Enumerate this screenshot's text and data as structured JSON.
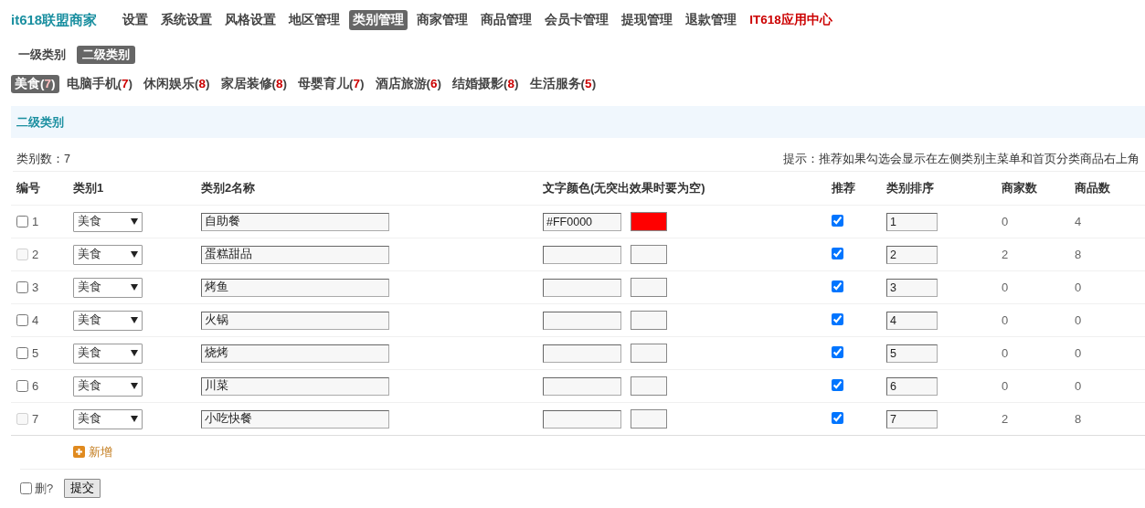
{
  "brand": "it618联盟商家",
  "nav": [
    {
      "label": "设置",
      "selected": false,
      "highlighted": false
    },
    {
      "label": "系统设置",
      "selected": false,
      "highlighted": false
    },
    {
      "label": "风格设置",
      "selected": false,
      "highlighted": false
    },
    {
      "label": "地区管理",
      "selected": false,
      "highlighted": false
    },
    {
      "label": "类别管理",
      "selected": true,
      "highlighted": false
    },
    {
      "label": "商家管理",
      "selected": false,
      "highlighted": false
    },
    {
      "label": "商品管理",
      "selected": false,
      "highlighted": false
    },
    {
      "label": "会员卡管理",
      "selected": false,
      "highlighted": false
    },
    {
      "label": "提现管理",
      "selected": false,
      "highlighted": false
    },
    {
      "label": "退款管理",
      "selected": false,
      "highlighted": false
    },
    {
      "label": "IT618应用中心",
      "selected": false,
      "highlighted": true
    }
  ],
  "level_tabs": [
    {
      "label": "一级类别",
      "selected": false
    },
    {
      "label": "二级类别",
      "selected": true
    }
  ],
  "category_tabs": [
    {
      "label": "美食(**7**)",
      "selected": true
    },
    {
      "label": "电脑手机(**7**)",
      "selected": false
    },
    {
      "label": "休闲娱乐(**8**)",
      "selected": false
    },
    {
      "label": "家居装修(**8**)",
      "selected": false
    },
    {
      "label": "母婴育儿(**7**)",
      "selected": false
    },
    {
      "label": "酒店旅游(**6**)",
      "selected": false
    },
    {
      "label": "结婚摄影(**8**)",
      "selected": false
    },
    {
      "label": "生活服务(**5**)",
      "selected": false
    }
  ],
  "section_title": "二级类别",
  "count_text": "类别数：7",
  "hint": "提示：推荐如果勾选会显示在左侧类别主菜单和首页分类商品右上角",
  "table": {
    "columns": [
      "编号",
      "类别1",
      "类别2名称",
      "文字颜色(无突出效果时要为空)",
      "推荐",
      "类别排序",
      "商家数",
      "商品数"
    ],
    "rows": [
      {
        "number": "1",
        "checked": false,
        "disabled": false,
        "category": "美食",
        "name": "自助餐",
        "color_text": "#FF0000",
        "recommended": true,
        "order": "1",
        "merchants": "0",
        "goods": "4"
      },
      {
        "number": "2",
        "checked": false,
        "disabled": true,
        "category": "美食",
        "name": "蛋糕甜品",
        "recommended": true,
        "order": "2",
        "merchants": "2",
        "goods": "8"
      },
      {
        "number": "3",
        "checked": false,
        "disabled": false,
        "category": "美食",
        "name": "烤鱼",
        "recommended": true,
        "order": "3",
        "merchants": "0",
        "goods": "0"
      },
      {
        "number": "4",
        "checked": false,
        "disabled": false,
        "category": "美食",
        "name": "火锅",
        "recommended": true,
        "order": "4",
        "merchants": "0",
        "goods": "0"
      },
      {
        "number": "5",
        "checked": false,
        "disabled": false,
        "category": "美食",
        "name": "烧烤",
        "recommended": true,
        "order": "5",
        "merchants": "0",
        "goods": "0"
      },
      {
        "number": "6",
        "checked": false,
        "disabled": false,
        "category": "美食",
        "name": "川菜",
        "recommended": true,
        "order": "6",
        "merchants": "0",
        "goods": "0"
      },
      {
        "number": "7",
        "checked": false,
        "disabled": true,
        "category": "美食",
        "name": "小吃快餐",
        "recommended": true,
        "order": "7",
        "merchants": "2",
        "goods": "8"
      }
    ]
  },
  "add_label": "新增",
  "delete": {
    "label": "删?",
    "checked": false
  },
  "submit_label": "提交"
}
